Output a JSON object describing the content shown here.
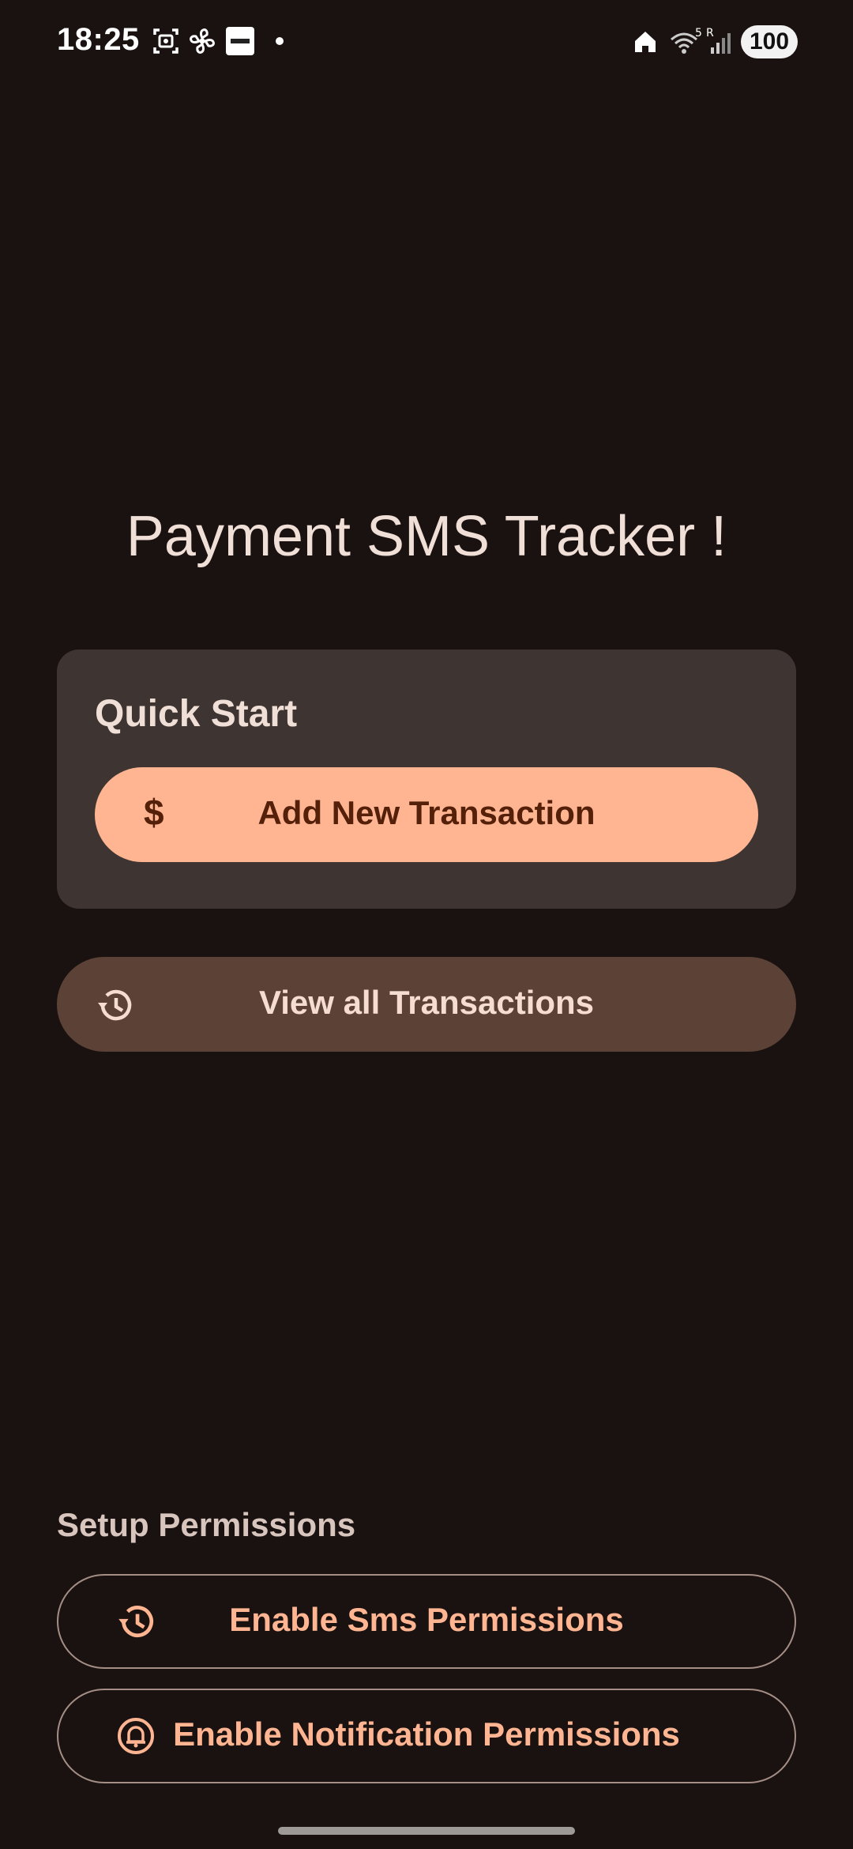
{
  "status_bar": {
    "time": "18:25",
    "battery": "100",
    "notification_icons": [
      "screenshot-icon",
      "fan-icon",
      "paytm-icon",
      "dot-icon"
    ],
    "system_icons": [
      "home-icon",
      "wifi-icon",
      "signal-icon",
      "battery-icon"
    ],
    "wifi_label": "5",
    "signal_label": "R"
  },
  "app": {
    "title": "Payment SMS Tracker !"
  },
  "quick_start": {
    "heading": "Quick Start",
    "add_button_icon": "$",
    "add_button_label": "Add New Transaction"
  },
  "view_all": {
    "label": "View all Transactions",
    "icon": "history-icon"
  },
  "permissions": {
    "heading": "Setup Permissions",
    "sms_label": "Enable Sms Permissions",
    "sms_icon": "history-icon",
    "notification_label": "Enable Notification Permissions",
    "notification_icon": "bell-icon"
  },
  "colors": {
    "background": "#1a1210",
    "card": "#3e3431",
    "primary": "#ffb591",
    "on_primary": "#55200a",
    "tonal": "#5c4236",
    "outline": "#a48e85"
  }
}
